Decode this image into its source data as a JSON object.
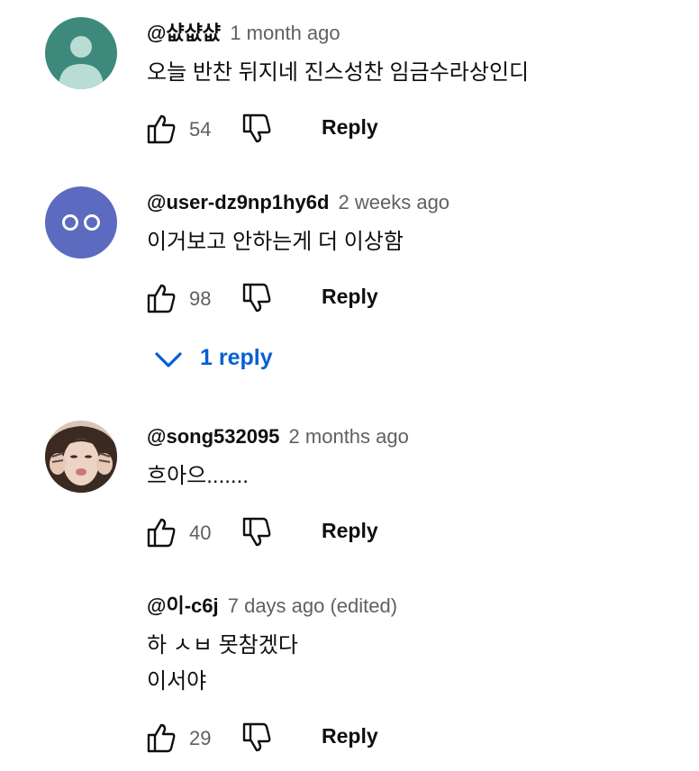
{
  "comments": [
    {
      "author": "@샶샶샶",
      "time": "1 month ago",
      "lines": [
        "오늘 반찬 뒤지네 진스성찬 임금수라상인디"
      ],
      "likes": "54",
      "reply_label": "Reply",
      "avatar": {
        "bg": "#3d8a7c",
        "fg": "#b9ddd5",
        "icon": "person-icon"
      }
    },
    {
      "author": "@user-dz9np1hy6d",
      "time": "2 weeks ago",
      "lines": [
        "이거보고 안하는게 더 이상함"
      ],
      "likes": "98",
      "reply_label": "Reply",
      "replies_label": "1 reply",
      "avatar": {
        "bg": "#5c6bc0",
        "fg": "#ffffff",
        "icon": "eyes-icon"
      }
    },
    {
      "author": "@song532095",
      "time": "2 months ago",
      "lines": [
        "흐아으......."
      ],
      "likes": "40",
      "reply_label": "Reply",
      "avatar": {
        "bg": "#d7c3b1",
        "icon": "photo-avatar"
      }
    },
    {
      "author": "@이-c6j",
      "time": "7 days ago (edited)",
      "lines": [
        "하 ㅅㅂ 못참겠다",
        "이서야"
      ],
      "likes": "29",
      "reply_label": "Reply"
    }
  ],
  "colors": {
    "link": "#065fd4",
    "secondary": "#606060",
    "primary": "#0f0f0f"
  }
}
